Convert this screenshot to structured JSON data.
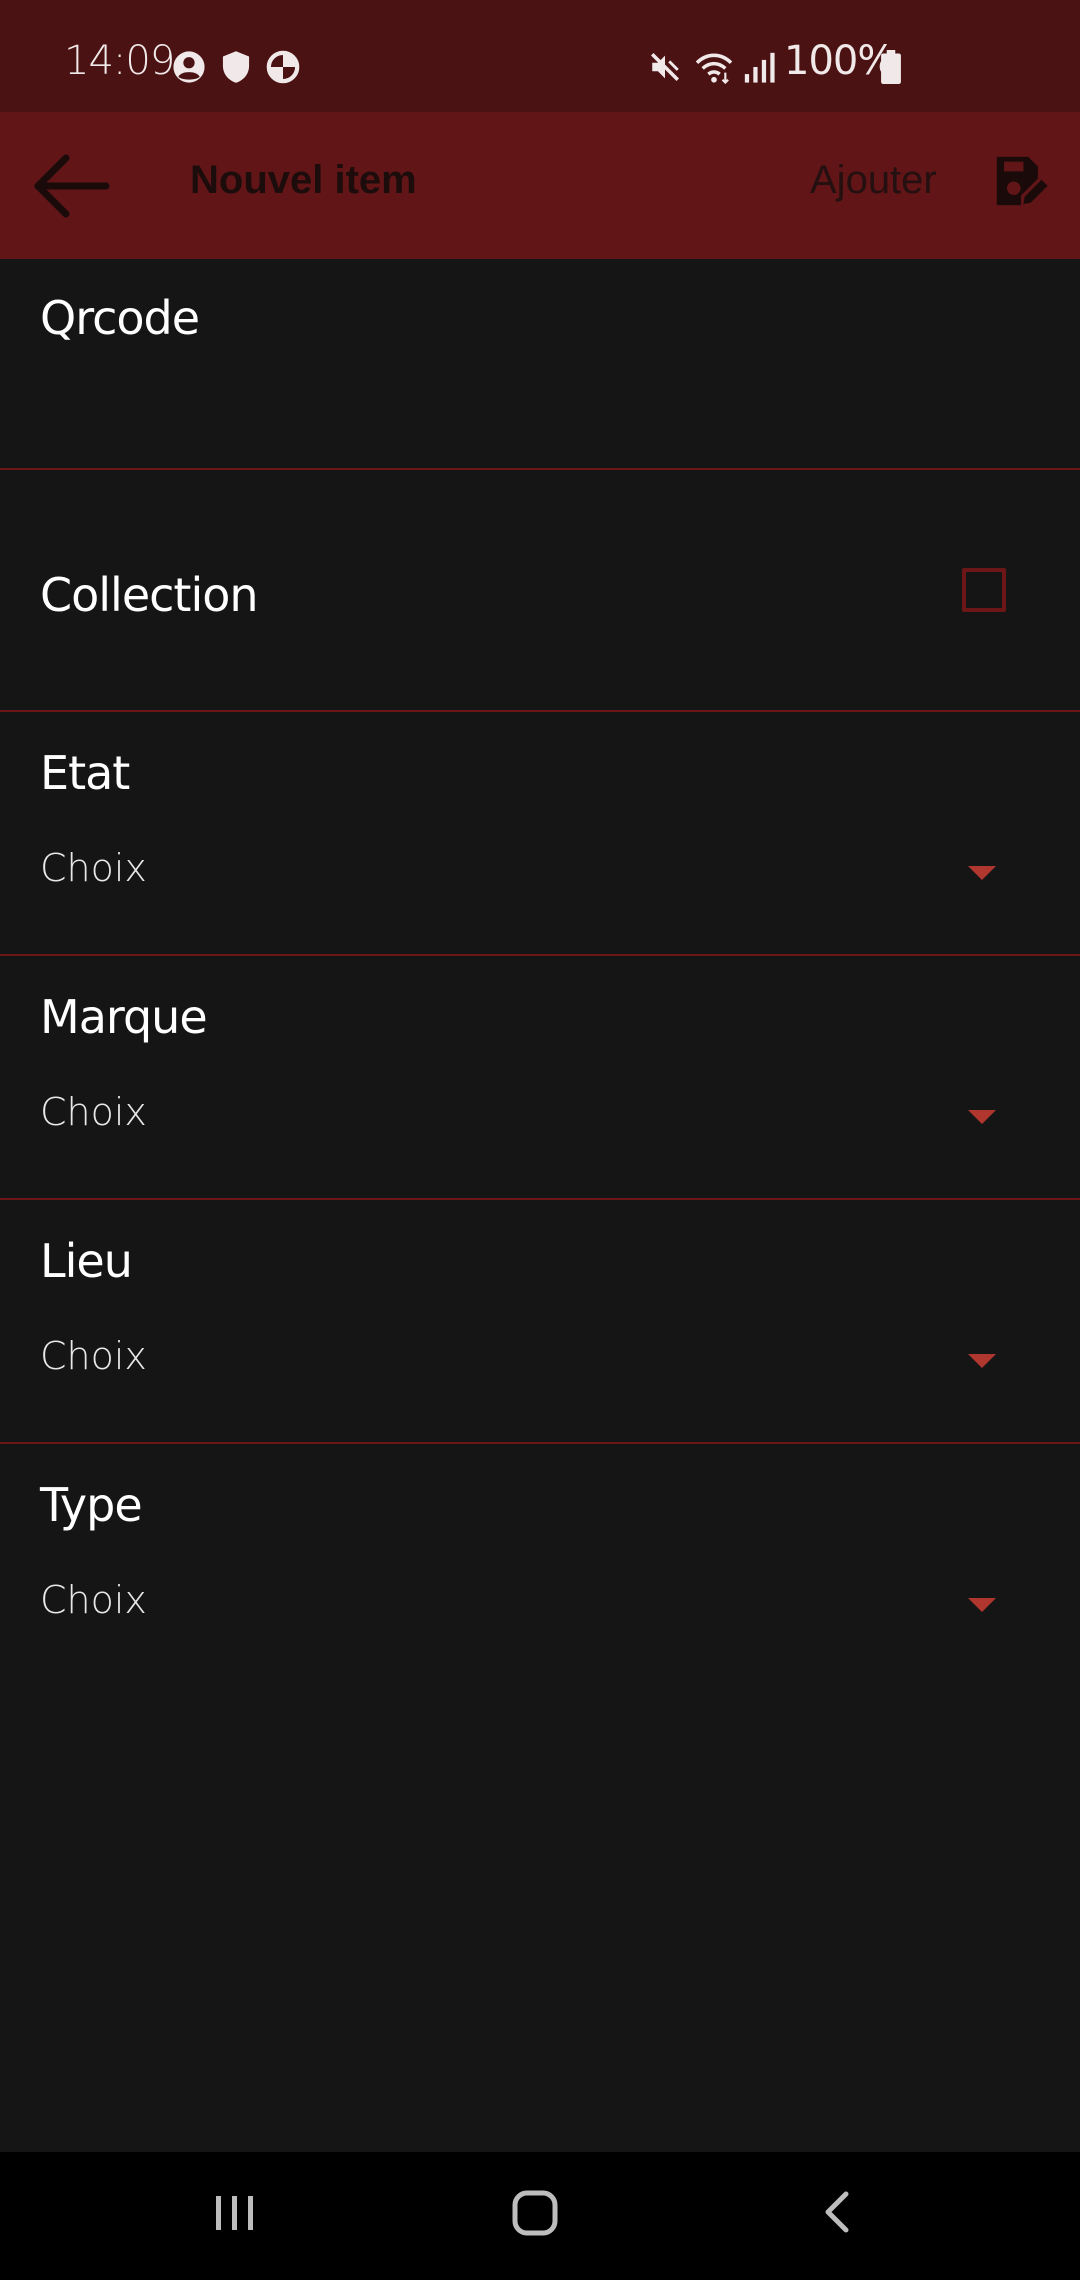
{
  "status_bar": {
    "time": "14:09",
    "battery_percent": "100%",
    "left_icons": [
      "account-circle-icon",
      "shield-icon",
      "data-saver-icon"
    ],
    "right_icons": [
      "mute-icon",
      "wifi-icon",
      "signal-icon",
      "battery-icon"
    ]
  },
  "app_bar": {
    "title": "Nouvel item",
    "add_label": "Ajouter",
    "back_icon": "arrow-left-icon",
    "save_icon": "save-edit-icon"
  },
  "form": {
    "qrcode_label": "Qrcode",
    "collection_label": "Collection",
    "collection_checked": false,
    "etat": {
      "label": "Etat",
      "value": "Choix"
    },
    "marque": {
      "label": "Marque",
      "value": "Choix"
    },
    "lieu": {
      "label": "Lieu",
      "value": "Choix"
    },
    "type": {
      "label": "Type",
      "value": "Choix"
    }
  },
  "nav_bar": {
    "buttons": [
      "recent-apps-icon",
      "home-icon",
      "back-icon"
    ]
  },
  "colors": {
    "status_bar_bg": "#4a1212",
    "app_bar_bg": "#611517",
    "screen_bg": "#151515",
    "divider": "#6d1618",
    "accent_arrow": "#b0372f"
  }
}
